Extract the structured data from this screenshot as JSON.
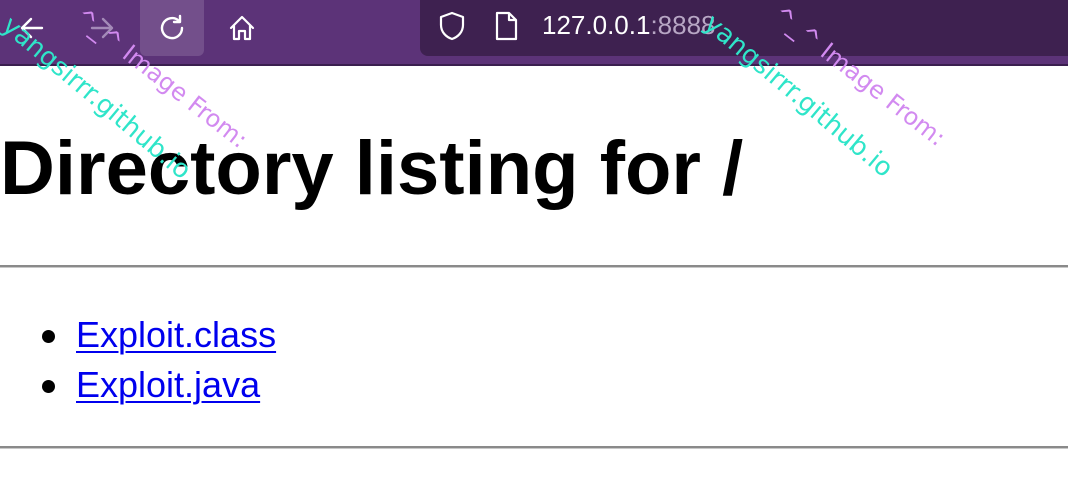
{
  "browser": {
    "nav": {
      "back_icon": "arrow-left-icon",
      "forward_icon": "arrow-right-icon",
      "reload_icon": "reload-icon",
      "home_icon": "home-icon"
    },
    "url": {
      "host": "127.0.0.1",
      "port": ":8888",
      "shield_icon": "shield-icon",
      "page_icon": "page-icon"
    },
    "colors": {
      "toolbar": "#5c3378",
      "urlbar": "#3e2150",
      "link": "#0000ee"
    }
  },
  "page": {
    "title": "Directory listing for /",
    "files": [
      {
        "name": "Exploit.class"
      },
      {
        "name": "Exploit.java"
      }
    ]
  },
  "watermarks": [
    {
      "from": "^_^ Image From:",
      "site": "yangsirrr.github.io"
    },
    {
      "from": "^_^ Image From:",
      "site": "yangsirrr.github.io"
    }
  ]
}
